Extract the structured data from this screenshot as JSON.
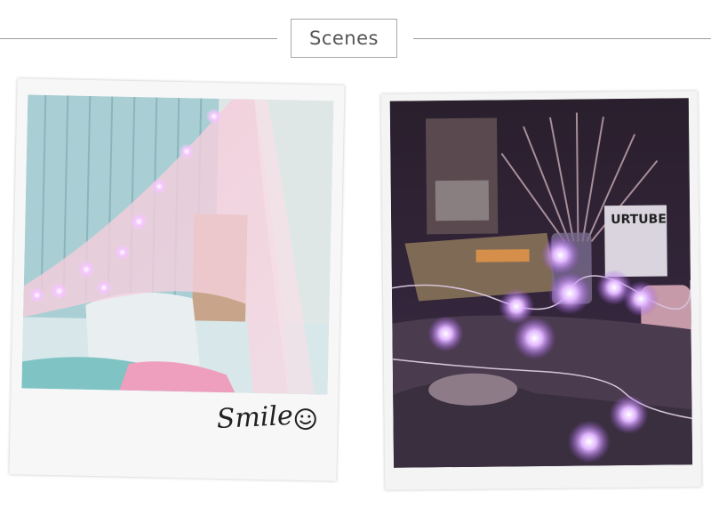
{
  "header": {
    "title": "Scenes"
  },
  "left_photo": {
    "caption": "Smile"
  },
  "right_photo": {
    "book_title": "URTUBE"
  },
  "colors": {
    "accent_pink": "#e9b7cf",
    "glow_purple": "#c98cff",
    "rule_gray": "#9a9a9a"
  }
}
